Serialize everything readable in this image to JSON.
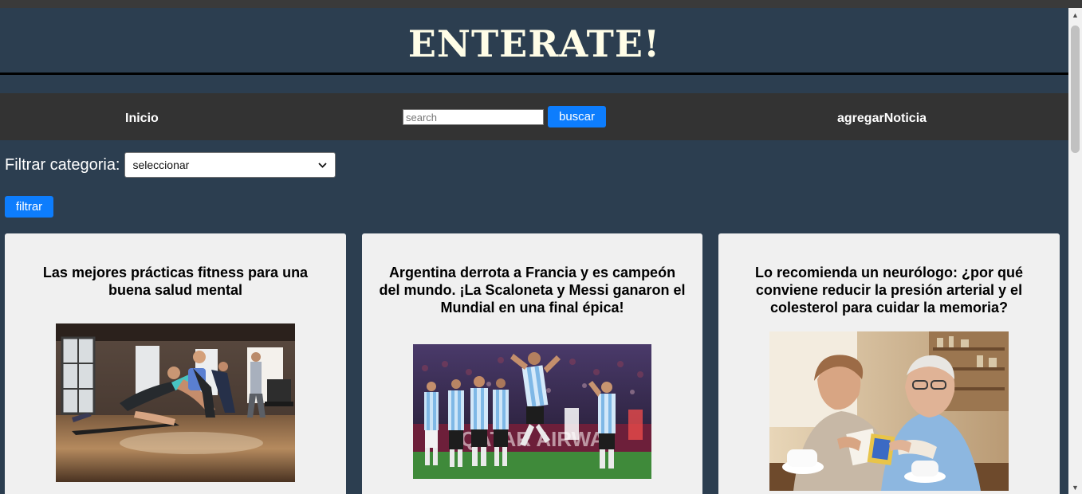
{
  "header": {
    "title": "ENTERATE!"
  },
  "nav": {
    "home": "Inicio",
    "search_placeholder": "search",
    "search_button": "buscar",
    "add": "agregarNoticia"
  },
  "filter": {
    "label": "Filtrar categoria:",
    "selected": "seleccionar",
    "button": "filtrar"
  },
  "cards": [
    {
      "title": "Las mejores prácticas fitness para una buena salud mental",
      "image": "fitness-workout-photo"
    },
    {
      "title": "Argentina derrota a Francia y es campeón del mundo. ¡La Scaloneta y Messi ganaron el Mundial en una final épica!",
      "image": "argentina-players-celebrating-photo"
    },
    {
      "title": "Lo recomienda un neurólogo: ¿por qué conviene reducir la presión arterial y el colesterol para cuidar la memoria?",
      "image": "elderly-couple-cards-photo"
    }
  ],
  "colors": {
    "page_bg": "#2c3e50",
    "navbar_bg": "#333333",
    "card_bg": "#f0f0f0",
    "button_blue": "#0d7dfd",
    "title_color": "#fffde7"
  }
}
